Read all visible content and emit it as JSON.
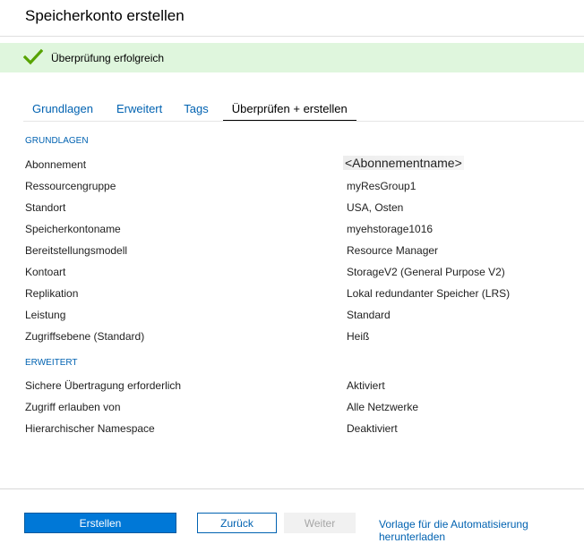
{
  "page": {
    "title": "Speicherkonto erstellen"
  },
  "banner": {
    "message": "Überprüfung erfolgreich",
    "color": "#dff6dd",
    "icon": "checkmark-icon"
  },
  "tabs": [
    {
      "label": "Grundlagen",
      "active": false
    },
    {
      "label": "Erweitert",
      "active": false
    },
    {
      "label": "Tags",
      "active": false
    },
    {
      "label": "Überprüfen + erstellen",
      "active": true
    }
  ],
  "basics": {
    "heading": "GRUNDLAGEN",
    "rows": [
      {
        "label": "Abonnement",
        "value": "<Abonnementname>"
      },
      {
        "label": "Ressourcengruppe",
        "value": "myResGroup1"
      },
      {
        "label": "Standort",
        "value": "USA, Osten"
      },
      {
        "label": "Speicherkontoname",
        "value": "myehstorage1016"
      },
      {
        "label": "Bereitstellungsmodell",
        "value": "Resource Manager"
      },
      {
        "label": "Kontoart",
        "value": "StorageV2 (General Purpose V2)"
      },
      {
        "label": "Replikation",
        "value": "Lokal redundanter Speicher (LRS)"
      },
      {
        "label": "Leistung",
        "value": "Standard"
      },
      {
        "label": "Zugriffsebene (Standard)",
        "value": "Heiß"
      }
    ]
  },
  "advanced": {
    "heading": "ERWEITERT",
    "rows": [
      {
        "label": "Sichere Übertragung erforderlich",
        "value": "Aktiviert"
      },
      {
        "label": "Zugriff erlauben von",
        "value": "Alle Netzwerke"
      },
      {
        "label": "Hierarchischer Namespace",
        "value": "Deaktiviert"
      }
    ]
  },
  "footer": {
    "create_label": "Erstellen",
    "back_label": "Zurück",
    "next_label": "Weiter",
    "template_link": "Vorlage für die Automatisierung herunterladen"
  },
  "colors": {
    "accent": "#0078d7",
    "link": "#0062b1",
    "success": "#57a300"
  }
}
